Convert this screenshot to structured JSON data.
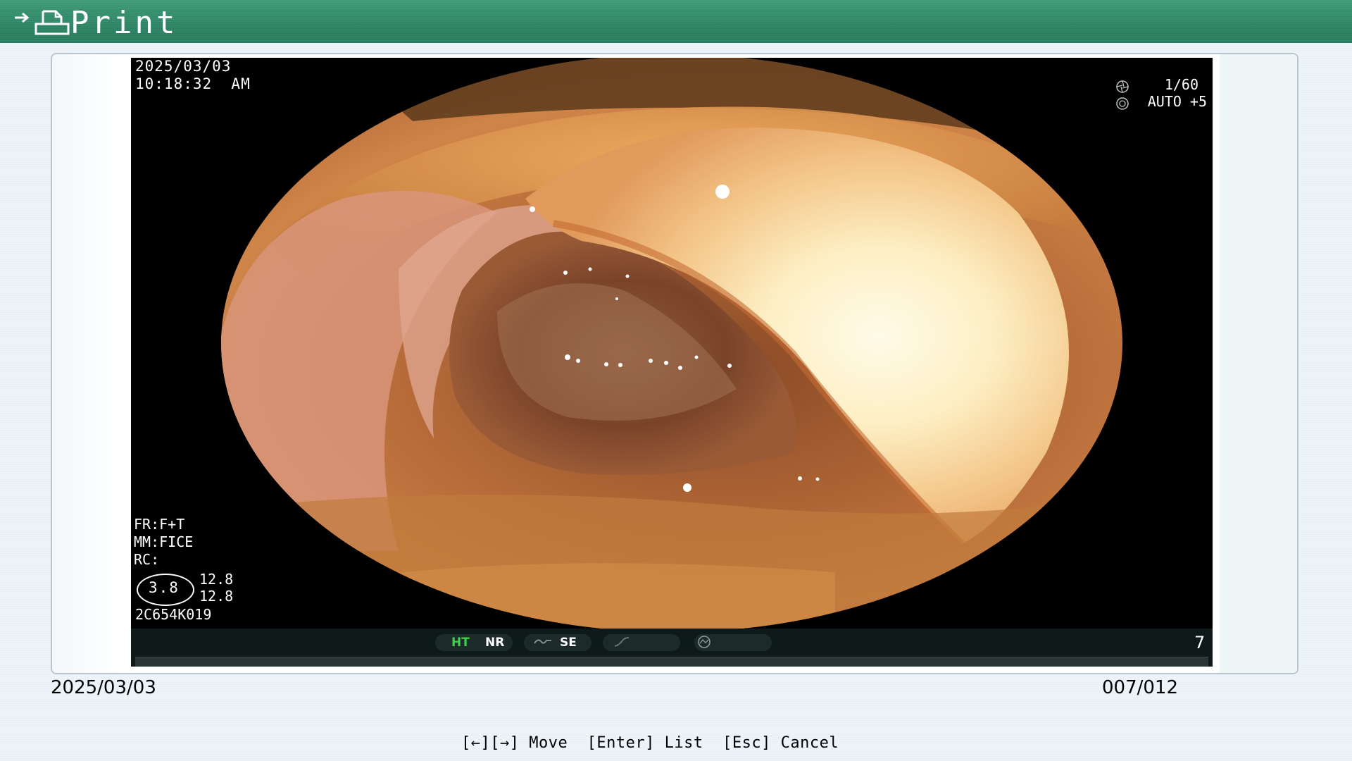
{
  "header": {
    "title": "Print",
    "arrow_icon": "arrow-right-icon",
    "printer_icon": "printer-icon",
    "color": "#2e8666"
  },
  "image": {
    "date": "2025/03/03",
    "time": "10:18:32  AM",
    "shutter": "1/60",
    "exposure": "AUTO +5",
    "fr": "FR:F+T",
    "mm": "MM:FICE",
    "rc": "RC:",
    "ring_value": "3.8",
    "value_1": "12.8",
    "value_2": "12.8",
    "serial": "2C654K019"
  },
  "status_bar": {
    "ht": "HT",
    "nr": "NR",
    "se": "SE",
    "page_number": "7",
    "ht_color": "#3ed14a"
  },
  "footer": {
    "date": "2025/03/03",
    "counter": "007/012",
    "hint": "[←][→] Move  [Enter] List  [Esc] Cancel"
  }
}
